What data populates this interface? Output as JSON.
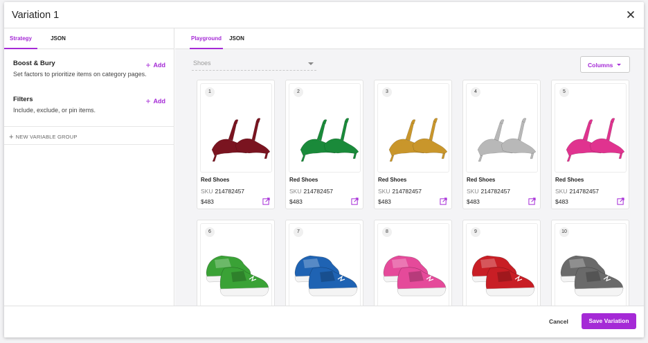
{
  "dialog": {
    "title": "Variation 1",
    "close_icon": "close-icon"
  },
  "left_tabs": [
    {
      "label": "Strategy",
      "active": true
    },
    {
      "label": "JSON",
      "active": false
    }
  ],
  "boost_bury": {
    "title": "Boost & Bury",
    "add_label": "Add",
    "description": "Set factors to prioritize items on category pages."
  },
  "filters": {
    "title": "Filters",
    "add_label": "Add",
    "description": "Include, exclude, or pin items."
  },
  "new_variable_group_label": "NEW VARIABLE GROUP",
  "right_tabs": [
    {
      "label": "Playground",
      "active": true
    },
    {
      "label": "JSON",
      "active": false
    }
  ],
  "category_select": {
    "value": "Shoes"
  },
  "columns_button": {
    "label": "Columns"
  },
  "sku_label": "SKU",
  "products": [
    {
      "num": "1",
      "name": "Red Shoes",
      "sku": "214782457",
      "price": "$483",
      "color": "#7a1420",
      "kind": "heel"
    },
    {
      "num": "2",
      "name": "Red Shoes",
      "sku": "214782457",
      "price": "$483",
      "color": "#1a8a3a",
      "kind": "heel"
    },
    {
      "num": "3",
      "name": "Red Shoes",
      "sku": "214782457",
      "price": "$483",
      "color": "#c9962b",
      "kind": "heel"
    },
    {
      "num": "4",
      "name": "Red Shoes",
      "sku": "214782457",
      "price": "$483",
      "color": "#b8b8b8",
      "kind": "heel"
    },
    {
      "num": "5",
      "name": "Red Shoes",
      "sku": "214782457",
      "price": "$483",
      "color": "#e0338f",
      "kind": "heel"
    },
    {
      "num": "6",
      "color": "#3aa236",
      "kind": "sneaker"
    },
    {
      "num": "7",
      "color": "#1f63b3",
      "kind": "sneaker"
    },
    {
      "num": "8",
      "color": "#e54a9a",
      "kind": "sneaker"
    },
    {
      "num": "9",
      "color": "#c81e25",
      "kind": "sneaker"
    },
    {
      "num": "10",
      "color": "#6a6a6a",
      "kind": "sneaker"
    }
  ],
  "footer": {
    "cancel_label": "Cancel",
    "save_label": "Save Variation"
  },
  "colors": {
    "accent": "#a52ad6"
  }
}
